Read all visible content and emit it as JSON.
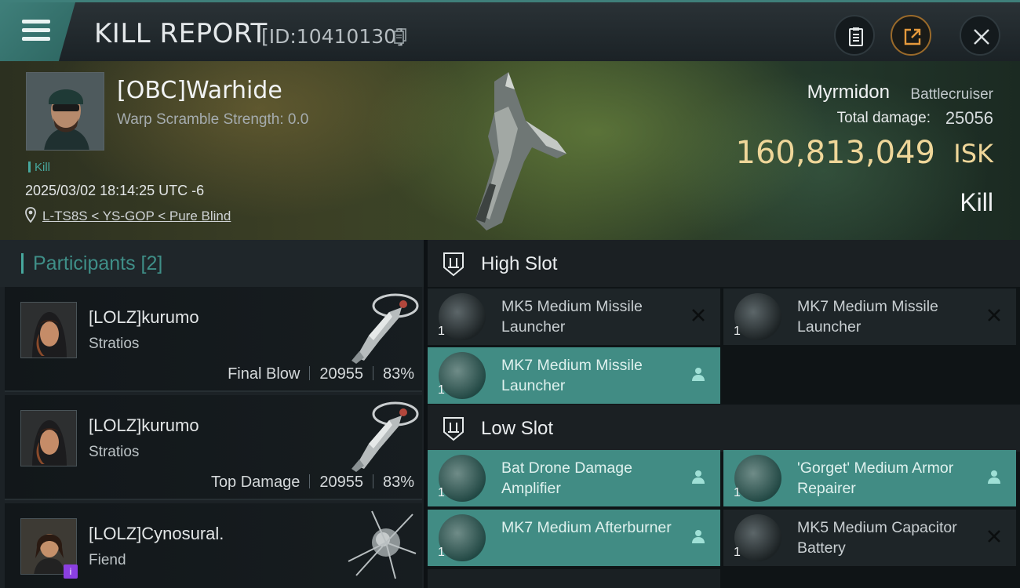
{
  "header": {
    "title": "KILL REPORT",
    "report_id": "[ID:10410130]"
  },
  "victim": {
    "name": "[OBC]Warhide",
    "scramble": "Warp Scramble Strength: 0.0",
    "tag": "Kill",
    "timestamp": "2025/03/02 18:14:25 UTC -6",
    "location": "L-TS8S < YS-GOP < Pure Blind",
    "ship": "Myrmidon",
    "ship_class": "Battlecruiser",
    "total_damage_label": "Total damage:",
    "total_damage": "25056",
    "isk_value": "160,813,049",
    "isk_unit": "ISK",
    "result": "Kill"
  },
  "participants": {
    "title": "Participants [2]",
    "items": [
      {
        "name": "[LOLZ]kurumo",
        "ship": "Stratios",
        "role": "Final Blow",
        "damage": "20955",
        "percent": "83%"
      },
      {
        "name": "[LOLZ]kurumo",
        "ship": "Stratios",
        "role": "Top Damage",
        "damage": "20955",
        "percent": "83%"
      },
      {
        "name": "[LOLZ]Cynosural.",
        "ship": "Fiend",
        "badge": "i"
      }
    ]
  },
  "fitting": {
    "high_slot_title": "High Slot",
    "low_slot_title": "Low Slot",
    "high": [
      {
        "qty": "1",
        "name": "MK5 Medium Missile Launcher",
        "status": "destroyed"
      },
      {
        "qty": "1",
        "name": "MK7 Medium Missile Launcher",
        "status": "destroyed"
      },
      {
        "qty": "1",
        "name": "MK7 Medium Missile Launcher",
        "status": "dropped"
      }
    ],
    "low": [
      {
        "qty": "1",
        "name": "Bat Drone Damage Amplifier",
        "status": "dropped"
      },
      {
        "qty": "1",
        "name": "'Gorget' Medium Armor Repairer",
        "status": "dropped"
      },
      {
        "qty": "1",
        "name": "MK7 Medium Afterburner",
        "status": "dropped"
      },
      {
        "qty": "1",
        "name": "MK5 Medium Capacitor Battery",
        "status": "destroyed"
      }
    ]
  },
  "colors": {
    "accent": "#418c84",
    "isk_gold": "#efd699",
    "badge_purple": "#8b3fe0"
  }
}
